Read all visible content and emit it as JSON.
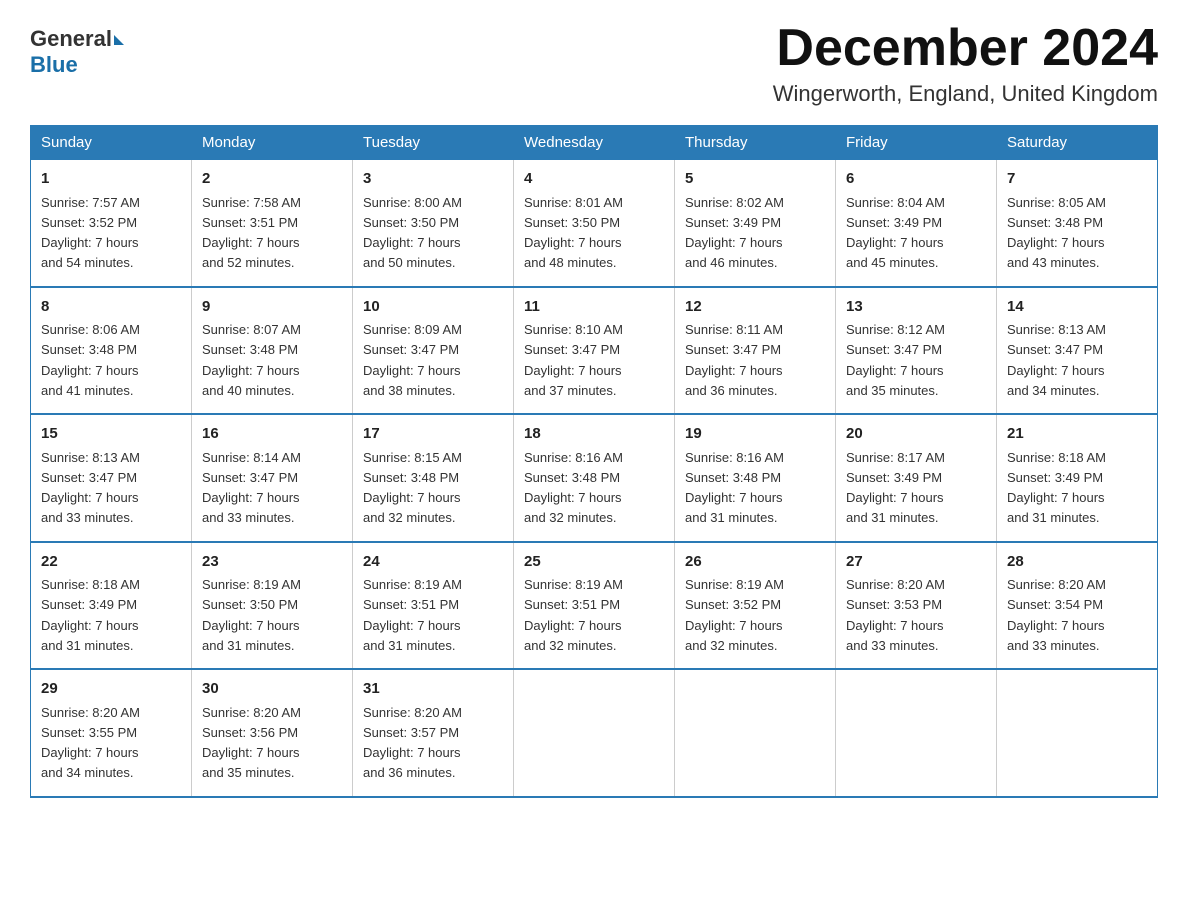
{
  "header": {
    "logo_general": "General",
    "logo_blue": "Blue",
    "month_title": "December 2024",
    "location": "Wingerworth, England, United Kingdom"
  },
  "days_of_week": [
    "Sunday",
    "Monday",
    "Tuesday",
    "Wednesday",
    "Thursday",
    "Friday",
    "Saturday"
  ],
  "weeks": [
    [
      {
        "day": "1",
        "sunrise": "7:57 AM",
        "sunset": "3:52 PM",
        "daylight": "7 hours and 54 minutes."
      },
      {
        "day": "2",
        "sunrise": "7:58 AM",
        "sunset": "3:51 PM",
        "daylight": "7 hours and 52 minutes."
      },
      {
        "day": "3",
        "sunrise": "8:00 AM",
        "sunset": "3:50 PM",
        "daylight": "7 hours and 50 minutes."
      },
      {
        "day": "4",
        "sunrise": "8:01 AM",
        "sunset": "3:50 PM",
        "daylight": "7 hours and 48 minutes."
      },
      {
        "day": "5",
        "sunrise": "8:02 AM",
        "sunset": "3:49 PM",
        "daylight": "7 hours and 46 minutes."
      },
      {
        "day": "6",
        "sunrise": "8:04 AM",
        "sunset": "3:49 PM",
        "daylight": "7 hours and 45 minutes."
      },
      {
        "day": "7",
        "sunrise": "8:05 AM",
        "sunset": "3:48 PM",
        "daylight": "7 hours and 43 minutes."
      }
    ],
    [
      {
        "day": "8",
        "sunrise": "8:06 AM",
        "sunset": "3:48 PM",
        "daylight": "7 hours and 41 minutes."
      },
      {
        "day": "9",
        "sunrise": "8:07 AM",
        "sunset": "3:48 PM",
        "daylight": "7 hours and 40 minutes."
      },
      {
        "day": "10",
        "sunrise": "8:09 AM",
        "sunset": "3:47 PM",
        "daylight": "7 hours and 38 minutes."
      },
      {
        "day": "11",
        "sunrise": "8:10 AM",
        "sunset": "3:47 PM",
        "daylight": "7 hours and 37 minutes."
      },
      {
        "day": "12",
        "sunrise": "8:11 AM",
        "sunset": "3:47 PM",
        "daylight": "7 hours and 36 minutes."
      },
      {
        "day": "13",
        "sunrise": "8:12 AM",
        "sunset": "3:47 PM",
        "daylight": "7 hours and 35 minutes."
      },
      {
        "day": "14",
        "sunrise": "8:13 AM",
        "sunset": "3:47 PM",
        "daylight": "7 hours and 34 minutes."
      }
    ],
    [
      {
        "day": "15",
        "sunrise": "8:13 AM",
        "sunset": "3:47 PM",
        "daylight": "7 hours and 33 minutes."
      },
      {
        "day": "16",
        "sunrise": "8:14 AM",
        "sunset": "3:47 PM",
        "daylight": "7 hours and 33 minutes."
      },
      {
        "day": "17",
        "sunrise": "8:15 AM",
        "sunset": "3:48 PM",
        "daylight": "7 hours and 32 minutes."
      },
      {
        "day": "18",
        "sunrise": "8:16 AM",
        "sunset": "3:48 PM",
        "daylight": "7 hours and 32 minutes."
      },
      {
        "day": "19",
        "sunrise": "8:16 AM",
        "sunset": "3:48 PM",
        "daylight": "7 hours and 31 minutes."
      },
      {
        "day": "20",
        "sunrise": "8:17 AM",
        "sunset": "3:49 PM",
        "daylight": "7 hours and 31 minutes."
      },
      {
        "day": "21",
        "sunrise": "8:18 AM",
        "sunset": "3:49 PM",
        "daylight": "7 hours and 31 minutes."
      }
    ],
    [
      {
        "day": "22",
        "sunrise": "8:18 AM",
        "sunset": "3:49 PM",
        "daylight": "7 hours and 31 minutes."
      },
      {
        "day": "23",
        "sunrise": "8:19 AM",
        "sunset": "3:50 PM",
        "daylight": "7 hours and 31 minutes."
      },
      {
        "day": "24",
        "sunrise": "8:19 AM",
        "sunset": "3:51 PM",
        "daylight": "7 hours and 31 minutes."
      },
      {
        "day": "25",
        "sunrise": "8:19 AM",
        "sunset": "3:51 PM",
        "daylight": "7 hours and 32 minutes."
      },
      {
        "day": "26",
        "sunrise": "8:19 AM",
        "sunset": "3:52 PM",
        "daylight": "7 hours and 32 minutes."
      },
      {
        "day": "27",
        "sunrise": "8:20 AM",
        "sunset": "3:53 PM",
        "daylight": "7 hours and 33 minutes."
      },
      {
        "day": "28",
        "sunrise": "8:20 AM",
        "sunset": "3:54 PM",
        "daylight": "7 hours and 33 minutes."
      }
    ],
    [
      {
        "day": "29",
        "sunrise": "8:20 AM",
        "sunset": "3:55 PM",
        "daylight": "7 hours and 34 minutes."
      },
      {
        "day": "30",
        "sunrise": "8:20 AM",
        "sunset": "3:56 PM",
        "daylight": "7 hours and 35 minutes."
      },
      {
        "day": "31",
        "sunrise": "8:20 AM",
        "sunset": "3:57 PM",
        "daylight": "7 hours and 36 minutes."
      },
      null,
      null,
      null,
      null
    ]
  ],
  "labels": {
    "sunrise_prefix": "Sunrise: ",
    "sunset_prefix": "Sunset: ",
    "daylight_prefix": "Daylight: "
  }
}
